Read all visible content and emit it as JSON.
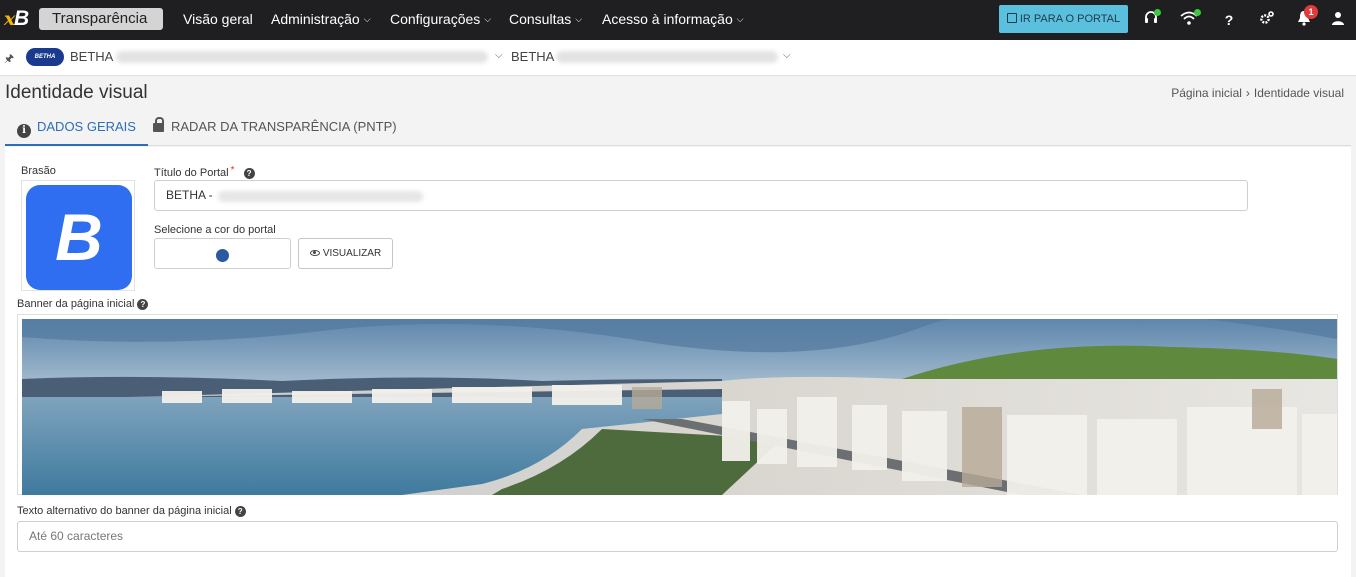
{
  "topbar": {
    "brand": "Transparência",
    "nav": [
      "Visão geral",
      "Administração",
      "Configurações",
      "Consultas",
      "Acesso à informação"
    ],
    "portal_button": "IR PARA O PORTAL",
    "notification_count": "1",
    "help": "?"
  },
  "context": {
    "logo_text": "BETHA",
    "entity": "BETHA",
    "secondary": "BETHA"
  },
  "page": {
    "title": "Identidade visual",
    "breadcrumb": [
      "Página inicial",
      "Identidade visual"
    ]
  },
  "tabs": [
    "DADOS GERAIS",
    "RADAR DA TRANSPARÊNCIA (PNTP)"
  ],
  "form": {
    "crest_label": "Brasão",
    "crest_letter": "B",
    "portal_title_label": "Título do Portal",
    "portal_title_value": "BETHA -",
    "required_mark": "*",
    "color_label": "Selecione a cor do portal",
    "color_value": "#2b5aa0",
    "visualize_button": "VISUALIZAR",
    "banner_label": "Banner da página inicial",
    "alt_text_label": "Texto alternativo do banner da página inicial",
    "alt_text_placeholder": "Até 60 caracteres"
  }
}
